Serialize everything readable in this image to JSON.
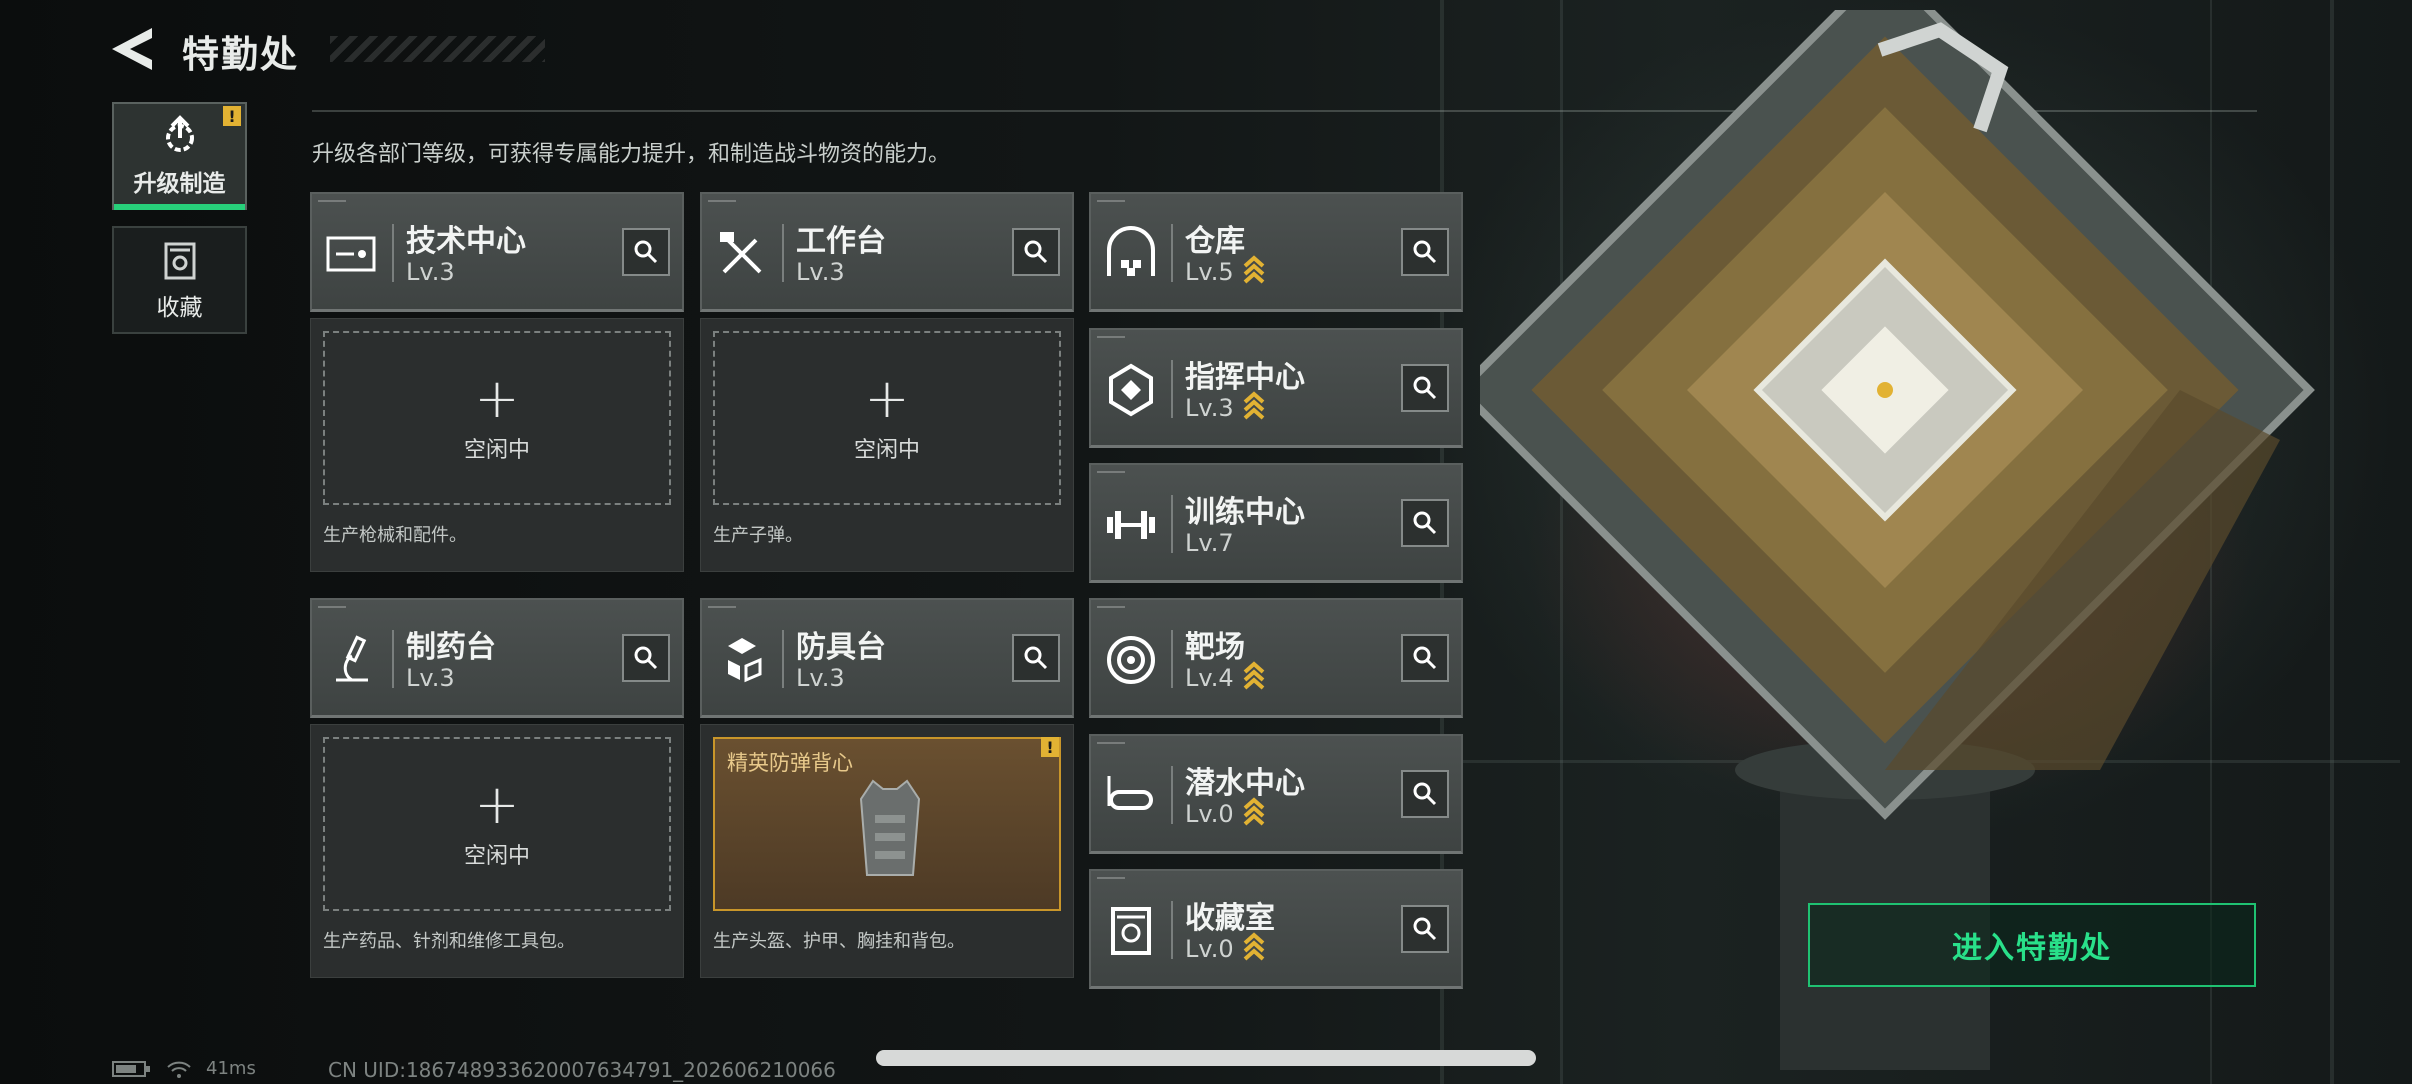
{
  "header": {
    "title": "特勤处",
    "subtitle": "升级各部门等级，可获得专属能力提升，和制造战斗物资的能力。"
  },
  "side_tabs": [
    {
      "label": "升级制造",
      "icon": "upgrade-gear-icon",
      "active": true,
      "badge": "!"
    },
    {
      "label": "收藏",
      "icon": "collection-icon",
      "active": false
    }
  ],
  "departments": [
    {
      "name": "技术中心",
      "level": "Lv.3",
      "icon": "tech-center-icon",
      "upgradable": false
    },
    {
      "name": "工作台",
      "level": "Lv.3",
      "icon": "workbench-icon",
      "upgradable": false
    },
    {
      "name": "仓库",
      "level": "Lv.5",
      "icon": "warehouse-icon",
      "upgradable": true
    },
    {
      "name": "指挥中心",
      "level": "Lv.3",
      "icon": "command-center-icon",
      "upgradable": true
    },
    {
      "name": "训练中心",
      "level": "Lv.7",
      "icon": "training-center-icon",
      "upgradable": false
    },
    {
      "name": "制药台",
      "level": "Lv.3",
      "icon": "pharmacy-icon",
      "upgradable": false
    },
    {
      "name": "防具台",
      "level": "Lv.3",
      "icon": "armor-bench-icon",
      "upgradable": false
    },
    {
      "name": "靶场",
      "level": "Lv.4",
      "icon": "shooting-range-icon",
      "upgradable": true
    },
    {
      "name": "潜水中心",
      "level": "Lv.0",
      "icon": "diving-center-icon",
      "upgradable": true
    },
    {
      "name": "收藏室",
      "level": "Lv.0",
      "icon": "collection-room-icon",
      "upgradable": true
    }
  ],
  "slots": [
    {
      "status": "空闲中",
      "plus": "+",
      "description": "生产枪械和配件。"
    },
    {
      "status": "空闲中",
      "plus": "+",
      "description": "生产子弹。"
    },
    {
      "status": "空闲中",
      "plus": "+",
      "description": "生产药品、针剂和维修工具包。"
    },
    {
      "item": "精英防弹背心",
      "badge": "!",
      "description": "生产头盔、护甲、胸挂和背包。"
    }
  ],
  "enter_button": {
    "label": "进入特勤处"
  },
  "status_bar": {
    "ping": "41ms",
    "uid": "CN UID:18674893362000763479​1_20260621006​6"
  },
  "colors": {
    "accent_green": "#27d07a",
    "upgrade_gold": "#e2b233",
    "panel": "#4c5150"
  }
}
